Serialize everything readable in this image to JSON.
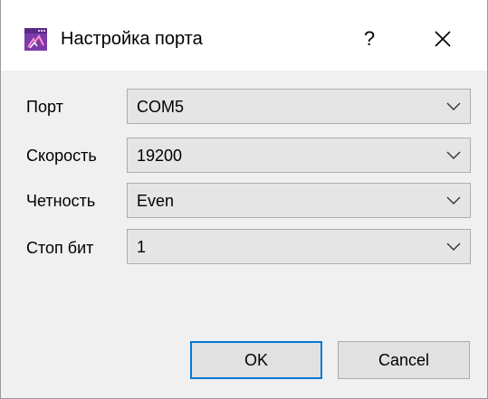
{
  "window": {
    "title": "Настройка порта",
    "help_label": "?",
    "icons": {
      "app": "app-icon",
      "close": "close-icon"
    }
  },
  "form": {
    "rows": [
      {
        "label": "Порт",
        "value": "COM5"
      },
      {
        "label": "Скорость",
        "value": "19200"
      },
      {
        "label": "Четность",
        "value": "Even"
      },
      {
        "label": "Стоп бит",
        "value": "1"
      }
    ]
  },
  "buttons": {
    "ok_label": "OK",
    "cancel_label": "Cancel"
  },
  "colors": {
    "accent": "#0078d7",
    "titlebar": "#ffffff",
    "background": "#f0f0f0"
  }
}
